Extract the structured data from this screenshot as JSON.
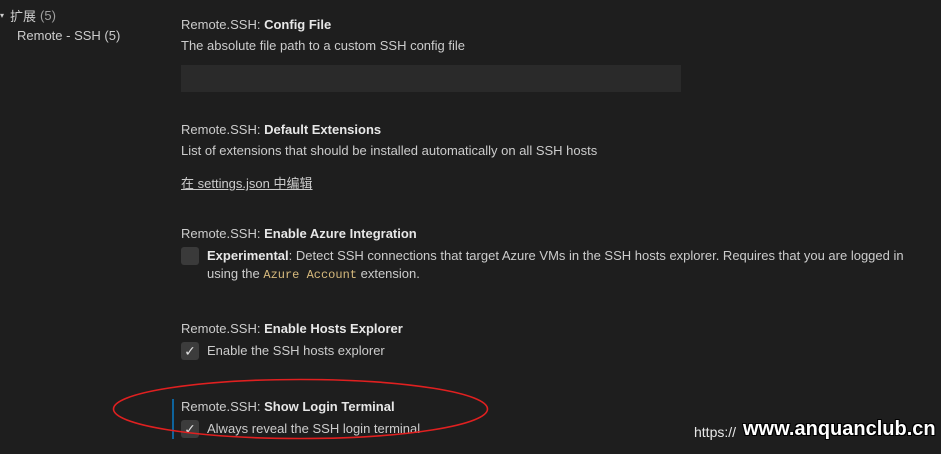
{
  "toc": {
    "root_label": "扩展",
    "root_count": "(5)",
    "child_label": "Remote - SSH (5)"
  },
  "settings": [
    {
      "category": "Remote.SSH: ",
      "name": "Config File",
      "description": "The absolute file path to a custom SSH config file",
      "input_value": ""
    },
    {
      "category": "Remote.SSH: ",
      "name": "Default Extensions",
      "description": "List of extensions that should be installed automatically on all SSH hosts",
      "link": "在 settings.json 中编辑"
    },
    {
      "category": "Remote.SSH: ",
      "name": "Enable Azure Integration",
      "checked": false,
      "label_bold": "Experimental",
      "label_text_1": ": Detect SSH connections that target Azure VMs in the SSH hosts explorer. Requires that you are logged in using the ",
      "label_code": "Azure Account",
      "label_text_2": " extension."
    },
    {
      "category": "Remote.SSH: ",
      "name": "Enable Hosts Explorer",
      "checked": true,
      "label": "Enable the SSH hosts explorer"
    },
    {
      "category": "Remote.SSH: ",
      "name": "Show Login Terminal",
      "checked": true,
      "label": "Always reveal the SSH login terminal"
    }
  ],
  "checkmark": "✓",
  "watermark": {
    "url": "https://",
    "site": "www.anquanclub.cn"
  },
  "colors": {
    "background": "#1e1e1e",
    "annotation": "#e02020",
    "focus": "#0e639c"
  }
}
